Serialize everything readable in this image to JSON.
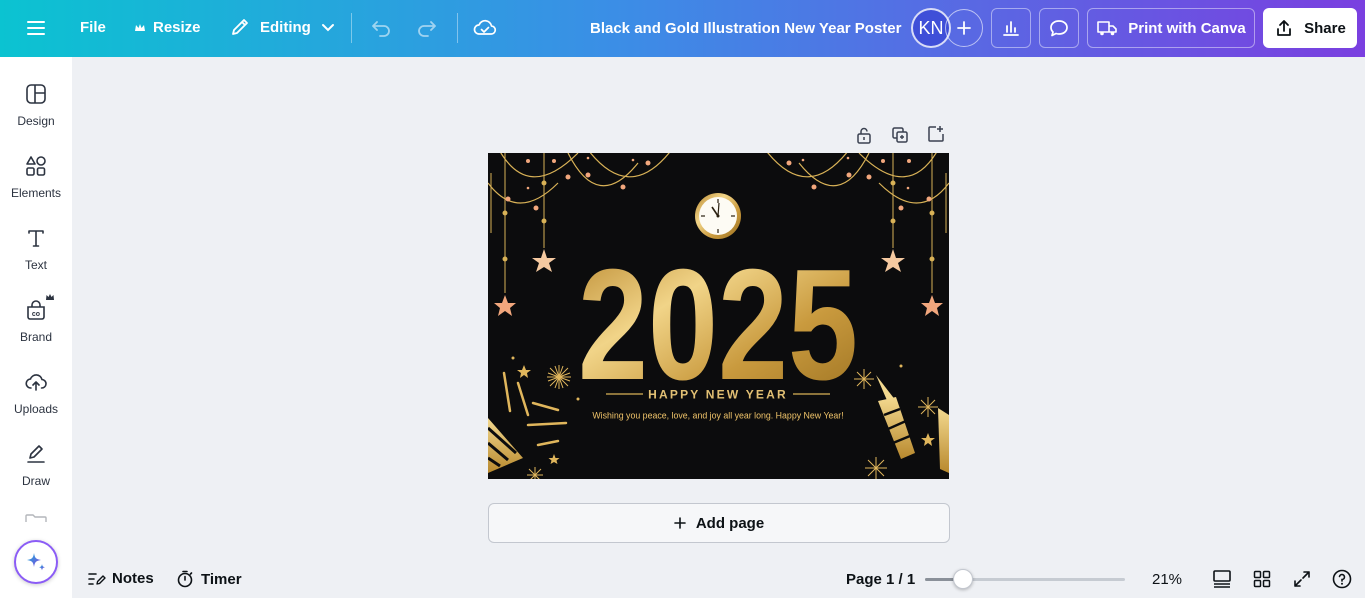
{
  "topbar": {
    "file_label": "File",
    "resize_label": "Resize",
    "mode_label": "Editing",
    "document_title": "Black and Gold Illustration New Year Poster",
    "avatar_initials": "KN",
    "print_label": "Print with Canva",
    "share_label": "Share"
  },
  "sidebar": {
    "items": [
      {
        "label": "Design",
        "icon": "design-icon"
      },
      {
        "label": "Elements",
        "icon": "elements-icon"
      },
      {
        "label": "Text",
        "icon": "text-icon"
      },
      {
        "label": "Brand",
        "icon": "brand-icon"
      },
      {
        "label": "Uploads",
        "icon": "uploads-icon"
      },
      {
        "label": "Draw",
        "icon": "draw-icon"
      }
    ]
  },
  "poster": {
    "year": "2025",
    "headline": "HAPPY NEW YEAR",
    "message": "Wishing you peace, love, and joy all year long. Happy New Year!"
  },
  "canvas": {
    "add_page_label": "Add page"
  },
  "bottombar": {
    "notes_label": "Notes",
    "timer_label": "Timer",
    "page_indicator": "Page 1 / 1",
    "zoom_percent": 21,
    "zoom_label": "21%"
  },
  "colors": {
    "gradient_start": "#0bc3d1",
    "gradient_end": "#7a3fe0",
    "poster_bg": "#0c0c0d",
    "gold": "#d9b257",
    "peach": "#f2a77d"
  }
}
